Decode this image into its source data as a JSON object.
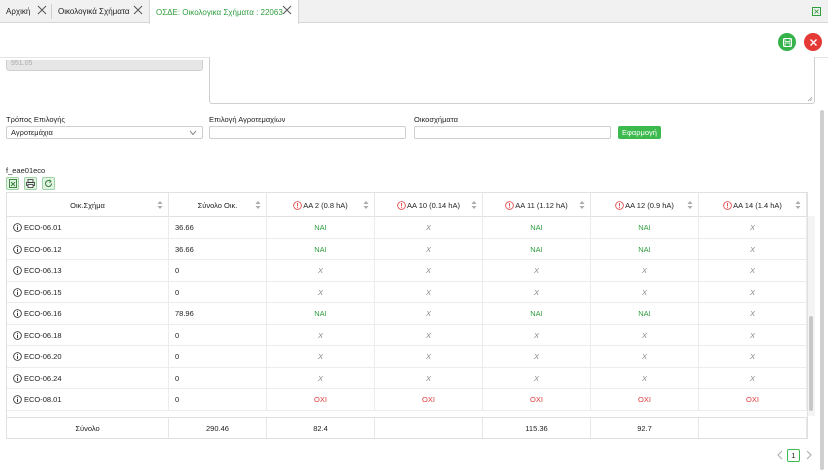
{
  "tabs": [
    {
      "label": "Αρχική"
    },
    {
      "label": "Οικολογικά Σχήματα"
    },
    {
      "label": "ΟΣΔΕ: Οικολογικα Σχήματα : 22063"
    }
  ],
  "form": {
    "partial_value": "951.05",
    "selection_mode_label": "Τρόπος Επιλογής",
    "selection_mode_value": "Αγροτεμάχια",
    "parcel_selection_label": "Επιλογή Αγροτεμαχίων",
    "parcel_selection_value": "",
    "eco_schemes_label": "Οικοσχήματα",
    "eco_schemes_value": "",
    "apply_label": "Εφαρμογή"
  },
  "table": {
    "title": "f_eae01eco",
    "columns": [
      "Οικ.Σχήμα",
      "Σύνολο Οικ.",
      "ΑΑ 2 (0.8 hA)",
      "ΑΑ 10 (0.14 hA)",
      "ΑΑ 11 (1.12 hA)",
      "ΑΑ 12 (0.9 hA)",
      "ΑΑ 14 (1.4 hA)"
    ],
    "rows": [
      {
        "scheme": "ECO-06.01",
        "total": "36.66",
        "cells": [
          "ΝΑΙ",
          "X",
          "ΝΑΙ",
          "ΝΑΙ",
          "X"
        ]
      },
      {
        "scheme": "ECO-06.12",
        "total": "36.66",
        "cells": [
          "ΝΑΙ",
          "X",
          "ΝΑΙ",
          "ΝΑΙ",
          "X"
        ]
      },
      {
        "scheme": "ECO-06.13",
        "total": "0",
        "cells": [
          "X",
          "X",
          "X",
          "X",
          "X"
        ]
      },
      {
        "scheme": "ECO-06.15",
        "total": "0",
        "cells": [
          "X",
          "X",
          "X",
          "X",
          "X"
        ]
      },
      {
        "scheme": "ECO-06.16",
        "total": "78.96",
        "cells": [
          "ΝΑΙ",
          "X",
          "ΝΑΙ",
          "ΝΑΙ",
          "X"
        ]
      },
      {
        "scheme": "ECO-06.18",
        "total": "0",
        "cells": [
          "X",
          "X",
          "X",
          "X",
          "X"
        ]
      },
      {
        "scheme": "ECO-06.20",
        "total": "0",
        "cells": [
          "X",
          "X",
          "X",
          "X",
          "X"
        ]
      },
      {
        "scheme": "ECO-06.24",
        "total": "0",
        "cells": [
          "X",
          "X",
          "X",
          "X",
          "X"
        ]
      },
      {
        "scheme": "ECO-08.01",
        "total": "0",
        "cells": [
          "ΟΧΙ",
          "ΟΧΙ",
          "ΟΧΙ",
          "ΟΧΙ",
          "ΟΧΙ"
        ]
      }
    ],
    "footer": [
      "Σύνολο",
      "290.46",
      "82.4",
      "",
      "115.36",
      "92.7",
      ""
    ]
  },
  "pager": {
    "current_page": "1"
  },
  "colors": {
    "accent": "#3dba4e",
    "yes": "#2e9e3e",
    "no": "#e03a3a",
    "cancel": "#e53935"
  }
}
